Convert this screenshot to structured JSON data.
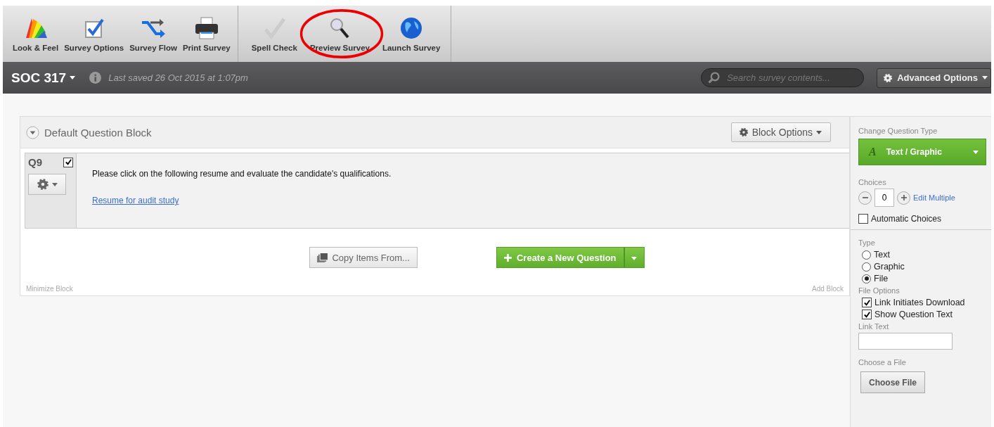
{
  "toolbar": {
    "groups": [
      [
        {
          "label": "Look & Feel",
          "circled": false
        },
        {
          "label": "Survey Options",
          "circled": false
        },
        {
          "label": "Survey Flow",
          "circled": false
        },
        {
          "label": "Print Survey",
          "circled": false
        }
      ],
      [
        {
          "label": "Spell Check",
          "circled": false
        },
        {
          "label": "Preview Survey",
          "circled": true
        },
        {
          "label": "Launch Survey",
          "circled": false
        }
      ]
    ]
  },
  "header": {
    "survey_name": "SOC 317",
    "last_saved": "Last saved 26 Oct 2015 at 1:07pm",
    "search": {
      "placeholder": "Search survey contents..."
    },
    "advanced_options": "Advanced Options"
  },
  "block": {
    "title": "Default Question Block",
    "block_options": "Block Options",
    "question": {
      "number": "Q9",
      "checked": true,
      "text": "Please click on the following resume and evaluate the candidate's qualifications.",
      "link": "Resume for audit study"
    },
    "copy_items": "Copy Items From...",
    "create_question": "Create a New Question",
    "minimize": "Minimize Block",
    "add_block": "Add Block"
  },
  "panel": {
    "change_type_label": "Change Question Type",
    "question_type_icon": "A",
    "question_type": "Text / Graphic",
    "choices_label": "Choices",
    "choices": "0",
    "edit_multiple": "Edit Multiple",
    "automatic_choices": {
      "label": "Automatic Choices",
      "checked": false
    },
    "type_label": "Type",
    "types": [
      {
        "label": "Text",
        "selected": false
      },
      {
        "label": "Graphic",
        "selected": false
      },
      {
        "label": "File",
        "selected": true
      }
    ],
    "file_options_label": "File Options",
    "file_options": [
      {
        "label": "Link Initiates Download",
        "checked": true
      },
      {
        "label": "Show Question Text",
        "checked": true
      }
    ],
    "link_text_label": "Link Text",
    "choose_file_label": "Choose a File",
    "choose_file": "Choose File"
  }
}
